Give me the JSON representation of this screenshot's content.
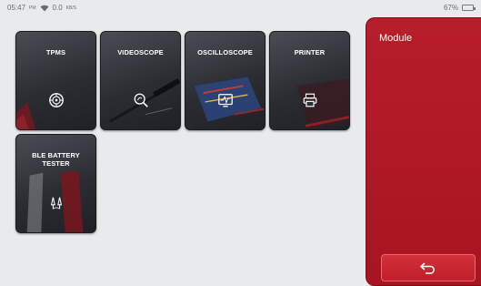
{
  "status_bar": {
    "time": "05:47",
    "ampm": "PM",
    "speed": "0.0",
    "speed_unit": "KB/S",
    "battery": "67%"
  },
  "modules": [
    {
      "label": "TPMS",
      "icon": "tire-sensor-icon"
    },
    {
      "label": "VIDEOSCOPE",
      "icon": "inspection-camera-icon"
    },
    {
      "label": "OSCILLOSCOPE",
      "icon": "waveform-monitor-icon"
    },
    {
      "label": "PRINTER",
      "icon": "printer-icon"
    },
    {
      "label": "BLE BATTERY TESTER",
      "icon": "battery-clamps-icon"
    }
  ],
  "panel": {
    "title": "Module",
    "back_icon": "return-arrow-icon"
  },
  "colors": {
    "panel": "#b71e2a",
    "tile": "#2b2d33",
    "background": "#e9eaec"
  }
}
